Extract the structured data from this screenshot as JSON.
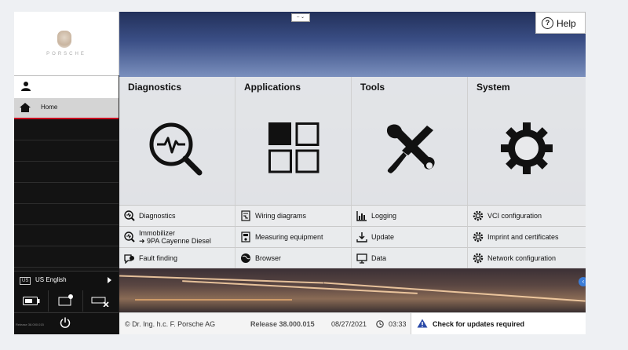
{
  "brand": {
    "wordmark": "PORSCHE"
  },
  "sidebar": {
    "home_label": "Home",
    "language_badge": "US",
    "language_label": "US English",
    "release_mini": "Release 38.000.015"
  },
  "header": {
    "toggle_label": "– ⌄",
    "help_label": "Help",
    "help_glyph": "?"
  },
  "columns": [
    {
      "title": "Diagnostics",
      "items": [
        "Diagnostics",
        "Immobilizer",
        "Fault finding"
      ],
      "immobilizer_sub": "➜ 9PA Cayenne Diesel"
    },
    {
      "title": "Applications",
      "items": [
        "Wiring diagrams",
        "Measuring equipment",
        "Browser"
      ]
    },
    {
      "title": "Tools",
      "items": [
        "Logging",
        "Update",
        "Data"
      ]
    },
    {
      "title": "System",
      "items": [
        "VCI configuration",
        "Imprint and certificates",
        "Network configuration"
      ]
    }
  ],
  "footer": {
    "copyright": "© Dr. Ing. h.c. F. Porsche AG",
    "release": "Release 38.000.015",
    "date": "08/27/2021",
    "time": "03:33",
    "warning": "Check for updates required"
  },
  "colors": {
    "accent_red": "#c8001e",
    "sky": "#3b4f86",
    "info_blue": "#3b7dd8"
  }
}
